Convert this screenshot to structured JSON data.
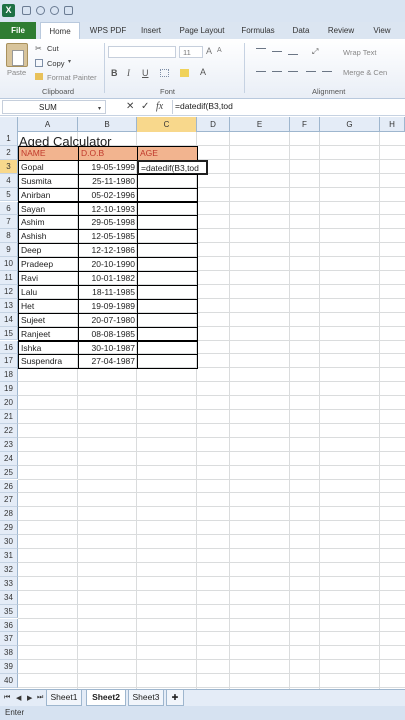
{
  "ribbon_tabs": [
    "File",
    "Home",
    "WPS PDF",
    "Insert",
    "Page Layout",
    "Formulas",
    "Data",
    "Review",
    "View"
  ],
  "clipboard": {
    "paste_label": "Paste",
    "cut_label": "Cut",
    "copy_label": "Copy",
    "format_painter_label": "Format Painter",
    "group_label": "Clipboard"
  },
  "font": {
    "size": "11",
    "group_label": "Font",
    "bold": "B",
    "italic": "I",
    "underline": "U"
  },
  "alignment": {
    "wrap_text_label": "Wrap Text",
    "merge_label": "Merge & Cen",
    "group_label": "Alignment"
  },
  "formula_bar": {
    "name_box": "SUM",
    "cancel": "✕",
    "enter": "✓",
    "fx": "fx",
    "formula": "=datedif(B3,tod"
  },
  "columns": [
    "A",
    "B",
    "C",
    "D",
    "E",
    "F",
    "G",
    "H"
  ],
  "rows": [
    "1",
    "2",
    "3",
    "4",
    "5",
    "6",
    "7",
    "8",
    "9",
    "10",
    "11",
    "12",
    "13",
    "14",
    "15",
    "16",
    "17",
    "18",
    "19",
    "20",
    "21",
    "22",
    "23",
    "24",
    "25",
    "26",
    "27",
    "28",
    "29",
    "30",
    "31",
    "32",
    "33",
    "34",
    "35",
    "36",
    "37",
    "38",
    "39",
    "40"
  ],
  "sheet": {
    "title": "Aged Calculator",
    "headers": {
      "name": "NAME",
      "dob": "D.O.B",
      "age": "AGE"
    },
    "records": [
      {
        "name": "Gopal",
        "dob": "19-05-1999"
      },
      {
        "name": "Susmita",
        "dob": "25-11-1980"
      },
      {
        "name": "Anirban",
        "dob": "05-02-1996"
      },
      {
        "name": "Sayan",
        "dob": "12-10-1993"
      },
      {
        "name": "Ashim",
        "dob": "29-05-1998"
      },
      {
        "name": "Ashish",
        "dob": "12-05-1985"
      },
      {
        "name": "Deep",
        "dob": "12-12-1986"
      },
      {
        "name": "Pradeep",
        "dob": "20-10-1990"
      },
      {
        "name": "Ravi",
        "dob": "10-01-1982"
      },
      {
        "name": "Lalu",
        "dob": "18-11-1985"
      },
      {
        "name": "Het",
        "dob": "19-09-1989"
      },
      {
        "name": "Sujeet",
        "dob": "20-07-1980"
      },
      {
        "name": "Ranjeet",
        "dob": "08-08-1985"
      },
      {
        "name": "Ishka",
        "dob": "30-10-1987"
      },
      {
        "name": "Suspendra",
        "dob": "27-04-1987"
      }
    ],
    "active_cell_text": "=datedif(B3,tod"
  },
  "sheet_tabs": [
    "Sheet1",
    "Sheet2",
    "Sheet3"
  ],
  "active_sheet": "Sheet2",
  "status": "Enter",
  "colors": {
    "file_tab": "#2f7d32",
    "header_fill": "#f2b48f",
    "header_text": "#c0392b",
    "active_header": "#f8d88c"
  }
}
